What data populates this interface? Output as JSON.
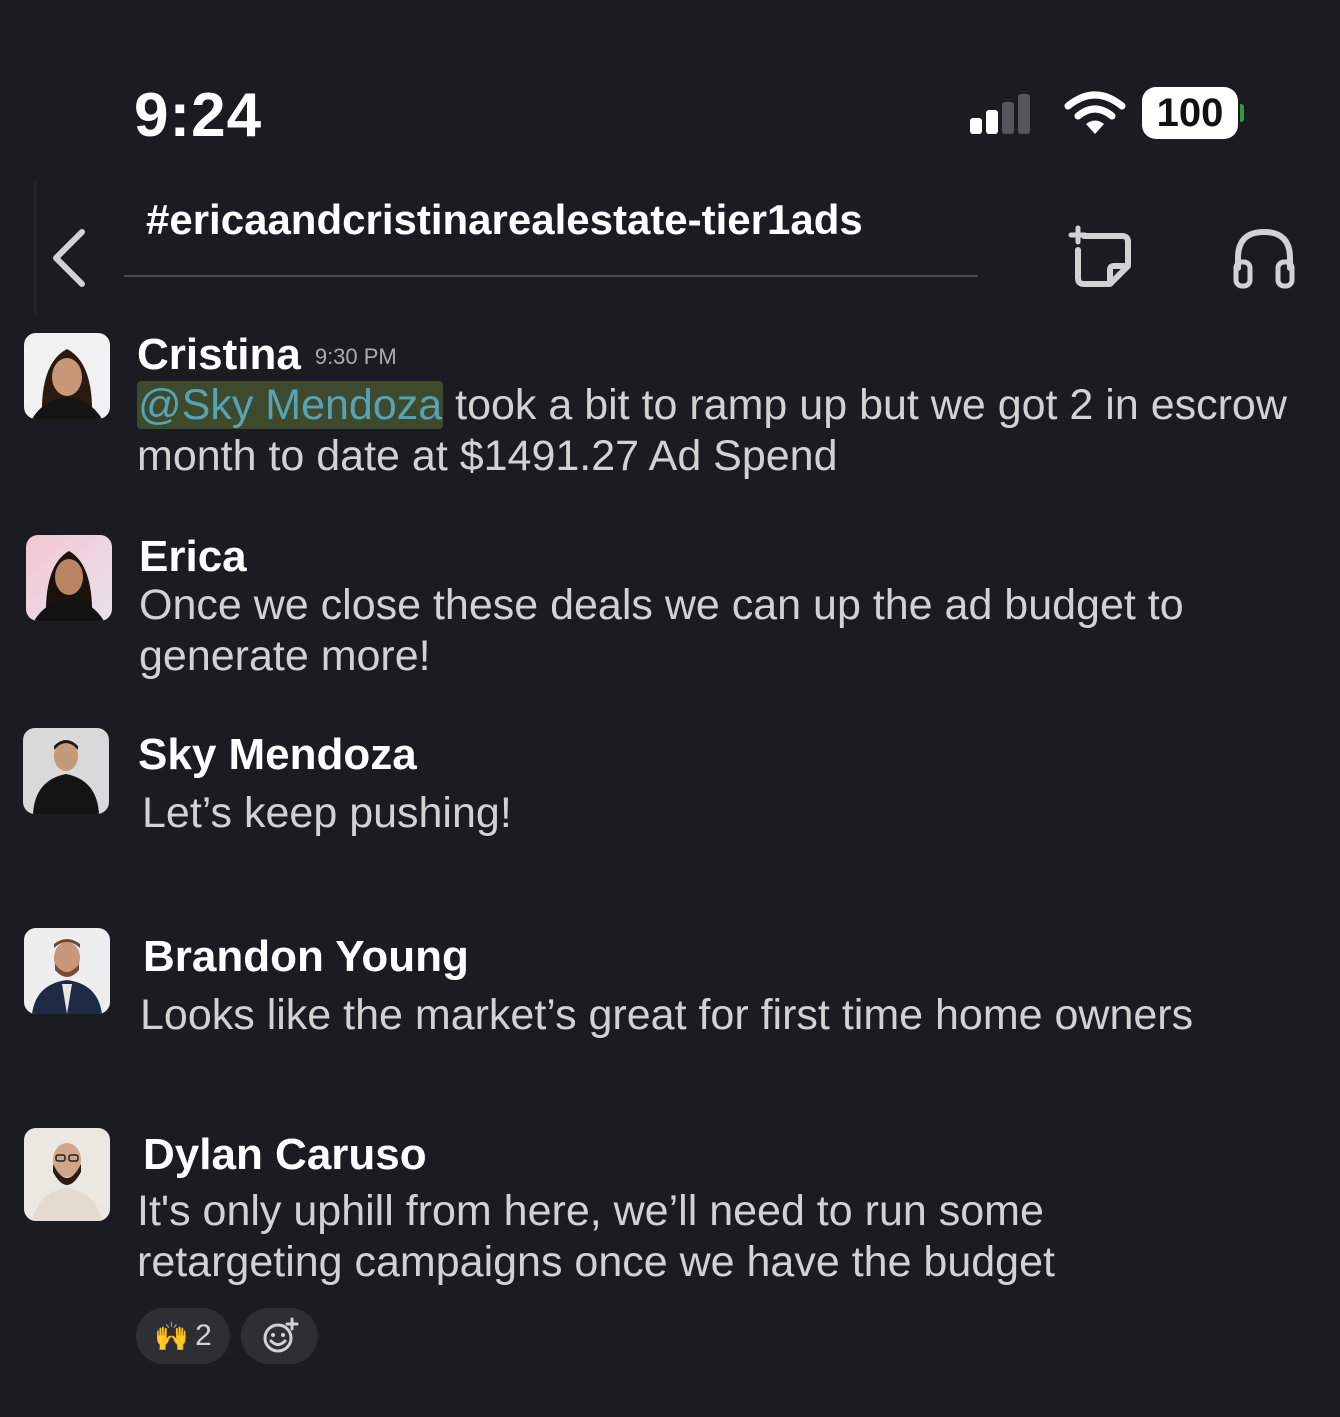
{
  "status_bar": {
    "time": "9:24",
    "battery": "100",
    "signal_icon": "signal-bars-icon",
    "wifi_icon": "wifi-icon"
  },
  "header": {
    "channel_name": "#ericaandcristinarealestate-tier1ads",
    "back_icon": "chevron-left-icon",
    "canvas_icon": "canvas-add-icon",
    "huddle_icon": "headphones-icon"
  },
  "messages": [
    {
      "author": "Cristina",
      "timestamp": "9:30 PM",
      "mention": "@Sky Mendoza",
      "text": " took a bit to ramp up but we got 2 in escrow month to date at $1491.27 Ad Spend"
    },
    {
      "author": "Erica",
      "text": "Once we close these deals we can up the ad budget to generate more!"
    },
    {
      "author": "Sky Mendoza",
      "text": "Let’s keep pushing!"
    },
    {
      "author": "Brandon Young",
      "text": "Looks like the market’s great for first time home owners"
    },
    {
      "author": "Dylan Caruso",
      "text": "It's only uphill from here, we’ll need to run some retargeting campaigns once we have the budget"
    }
  ],
  "reactions": [
    {
      "emoji": "🙌",
      "count": "2"
    }
  ],
  "add_reaction_icon": "add-reaction-icon",
  "colors": {
    "background": "#1b1c21",
    "mention_bg": "#3e4a2e",
    "mention_text": "#56a3b3",
    "battery_charge": "#2f9a46"
  }
}
